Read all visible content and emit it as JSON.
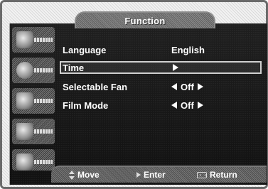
{
  "menu": {
    "title": "Function",
    "items": [
      {
        "name": "Language",
        "value": "English",
        "has_left_arrow": false,
        "has_right_arrow": false
      },
      {
        "name": "Time",
        "value": "",
        "has_left_arrow": false,
        "has_right_arrow": true,
        "selected": true
      },
      {
        "name": "Selectable Fan",
        "value": "Off",
        "has_left_arrow": true,
        "has_right_arrow": true
      },
      {
        "name": "Film Mode",
        "value": "Off",
        "has_left_arrow": true,
        "has_right_arrow": true
      }
    ],
    "side_icons": [
      "picture-menu-icon",
      "sound-menu-icon",
      "channel-menu-icon",
      "setup-menu-icon",
      "input-menu-icon"
    ]
  },
  "footer": {
    "move_label": "Move",
    "enter_label": "Enter",
    "return_label": "Return"
  },
  "colors": {
    "osd_background": "#151515",
    "text": "#ffffff",
    "highlight_border": "#d0d0d0"
  }
}
